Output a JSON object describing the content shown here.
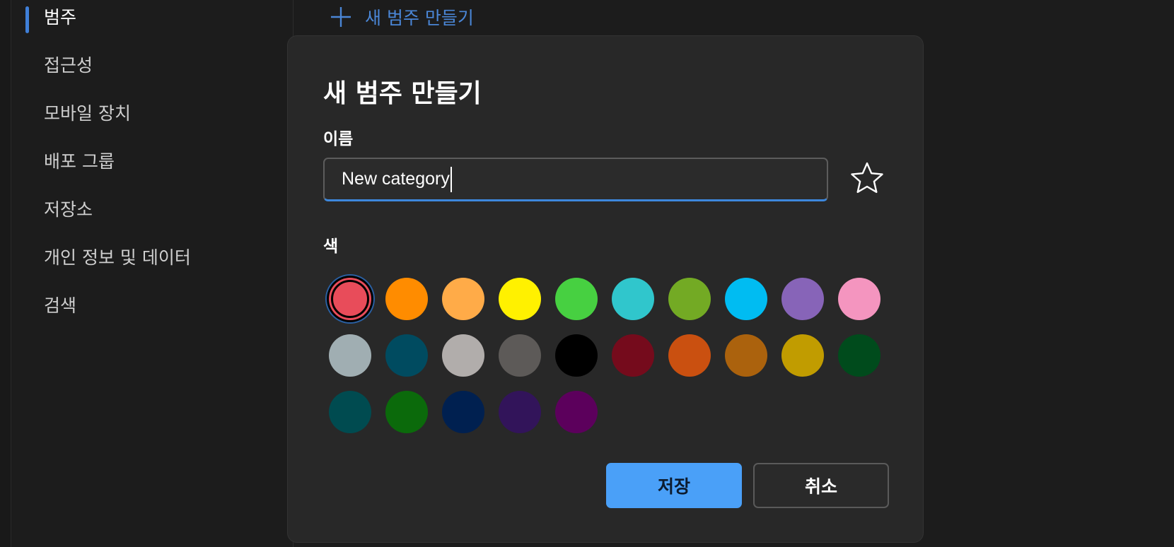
{
  "sidebar": {
    "items": [
      {
        "label": "범주",
        "active": true
      },
      {
        "label": "접근성"
      },
      {
        "label": "모바일 장치"
      },
      {
        "label": "배포 그룹"
      },
      {
        "label": "저장소"
      },
      {
        "label": "개인 정보 및 데이터"
      },
      {
        "label": "검색"
      }
    ]
  },
  "header": {
    "create_label": "새 범주 만들기",
    "create_icon": "plus-icon",
    "accent_color": "#4a86d6"
  },
  "dialog": {
    "title": "새 범주 만들기",
    "name_label": "이름",
    "name_value": "New category",
    "favorite_icon": "star-icon",
    "color_label": "색",
    "selected_color": "#e84c5a",
    "colors": [
      "#e84c5a",
      "#ff8c00",
      "#ffab48",
      "#fff100",
      "#47d041",
      "#30c6cc",
      "#73aa24",
      "#00bcf2",
      "#8764b8",
      "#f495bf",
      "#a0aeb2",
      "#004b60",
      "#b1adab",
      "#5d5a58",
      "#000000",
      "#750b1c",
      "#ca5010",
      "#ab620d",
      "#c19c00",
      "#004b1c",
      "#004b50",
      "#0b6a0b",
      "#002050",
      "#32145a",
      "#5c005c"
    ],
    "save_label": "저장",
    "cancel_label": "취소",
    "save_color": "#4aa0f8"
  }
}
